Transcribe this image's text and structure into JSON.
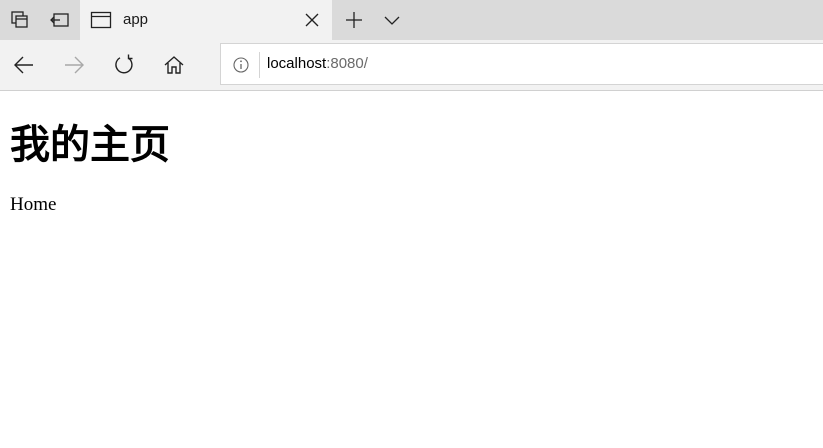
{
  "browser": {
    "tab": {
      "title": "app"
    },
    "address": {
      "host": "localhost",
      "rest": ":8080/"
    }
  },
  "page": {
    "heading": "我的主页",
    "link": "Home"
  }
}
